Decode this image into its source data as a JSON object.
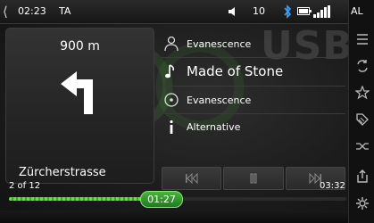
{
  "status_bar": {
    "back_icon": "chevron-left-icon",
    "time": "02:23",
    "traffic_announcement": "TA",
    "volume_icon": "speaker-icon",
    "volume": "10",
    "bluetooth_icon": "bluetooth-icon",
    "battery_icon": "battery-icon",
    "signal_icon": "signal-bars-icon"
  },
  "side_rail": {
    "label": "AL",
    "items": [
      {
        "name": "list-icon"
      },
      {
        "name": "repeat-icon"
      },
      {
        "name": "star-icon"
      },
      {
        "name": "tag-icon"
      },
      {
        "name": "shuffle-icon"
      },
      {
        "name": "export-icon"
      },
      {
        "name": "settings-icon"
      }
    ]
  },
  "navigation": {
    "distance": "900 m",
    "turn_icon": "turn-left-arrow-icon",
    "street": "Zürcherstrasse"
  },
  "watermark": {
    "source": "USB"
  },
  "track": {
    "artist": "Evanescence",
    "title": "Made of Stone",
    "album": "Evanescence",
    "genre": "Alternative",
    "artist_icon": "person-icon",
    "title_icon": "music-note-icon",
    "album_icon": "disc-icon",
    "genre_icon": "info-icon"
  },
  "controls": {
    "prev_icon": "skip-back-icon",
    "pause_icon": "pause-icon",
    "next_icon": "skip-forward-icon"
  },
  "progress": {
    "track_position": "2 of 12",
    "elapsed": "01:27",
    "duration": "03:32",
    "fraction": 0.41
  },
  "colors": {
    "accent": "#4cc43a",
    "background": "#1c1c1c"
  }
}
